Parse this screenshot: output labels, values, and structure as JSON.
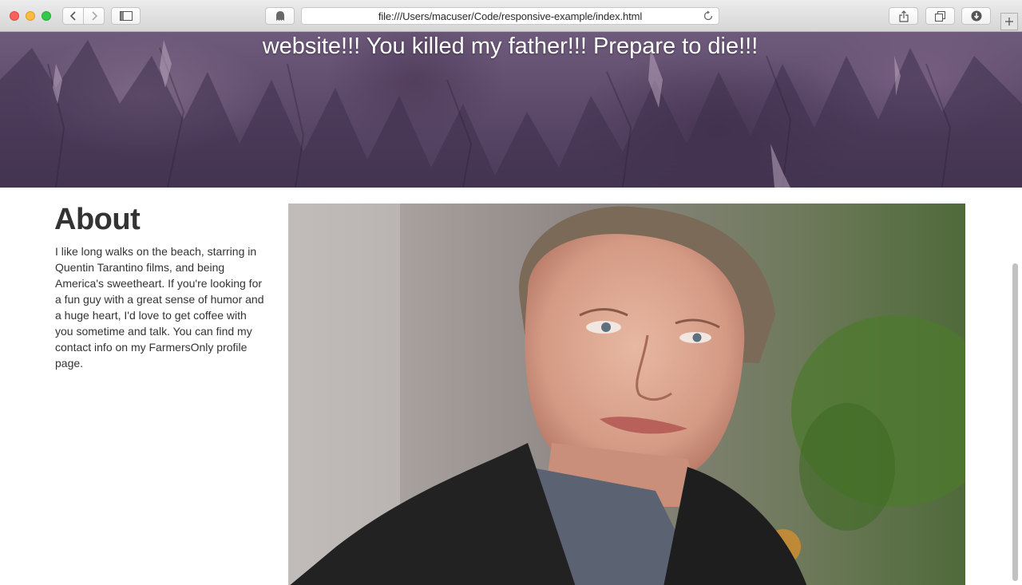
{
  "browser": {
    "url": "file:///Users/macuser/Code/responsive-example/index.html"
  },
  "hero": {
    "title": "website!!! You killed my father!!! Prepare to die!!!"
  },
  "about": {
    "heading": "About",
    "body": "I like long walks on the beach, starring in Quentin Tarantino films, and being America's sweetheart. If you're looking for a fun guy with a great sense of humor and a huge heart, I'd love to get coffee with you sometime and talk. You can find my contact info on my FarmersOnly profile page."
  },
  "colors": {
    "hero_tint": "#5b4868",
    "text": "#333333"
  }
}
